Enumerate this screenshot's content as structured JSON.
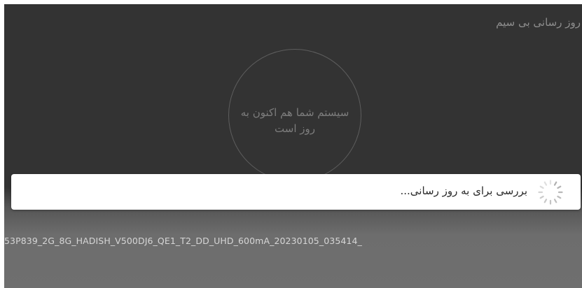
{
  "header": {
    "title": "روز رسانی بی سیم"
  },
  "status": {
    "message": "سیستم شما هم اکنون به روز است"
  },
  "dialog": {
    "message": "بررسی برای به روز رسانی...",
    "spinner_icon": "loading-spinner-icon"
  },
  "footer": {
    "build_string": "53P839_2G_8G_HADISH_V500DJ6_QE1_T2_DD_UHD_600mA_20230105_035414_"
  },
  "colors": {
    "background": "#333333",
    "dialog_background": "#ffffff",
    "spinner": "#b0b0b0"
  }
}
